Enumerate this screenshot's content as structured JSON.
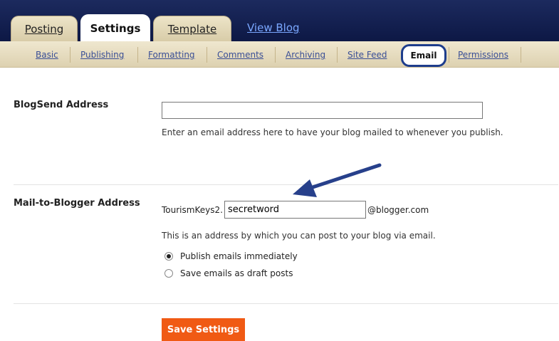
{
  "tabs": {
    "posting": "Posting",
    "settings": "Settings",
    "template": "Template",
    "view_blog": "View Blog"
  },
  "subnav": {
    "basic": "Basic",
    "publishing": "Publishing",
    "formatting": "Formatting",
    "comments": "Comments",
    "archiving": "Archiving",
    "site_feed": "Site Feed",
    "email": "Email",
    "permissions": "Permissions"
  },
  "blogsend": {
    "label": "BlogSend Address",
    "value": "",
    "help": "Enter an email address here to have your blog mailed to whenever you publish."
  },
  "mail_to_blogger": {
    "label": "Mail-to-Blogger Address",
    "prefix": "TourismKeys2.",
    "value": "secretword",
    "suffix": "@blogger.com",
    "help": "This is an address by which you can post to your blog via email.",
    "options": [
      {
        "label": "Publish emails immediately",
        "selected": true
      },
      {
        "label": "Save emails as draft posts",
        "selected": false
      }
    ]
  },
  "annotation": {
    "arrow_color": "#27408b"
  },
  "save_button": "Save Settings",
  "colors": {
    "save_button": "#f05a14",
    "header_bg": "#0d1845",
    "active_highlight": "#1d3d8c"
  }
}
